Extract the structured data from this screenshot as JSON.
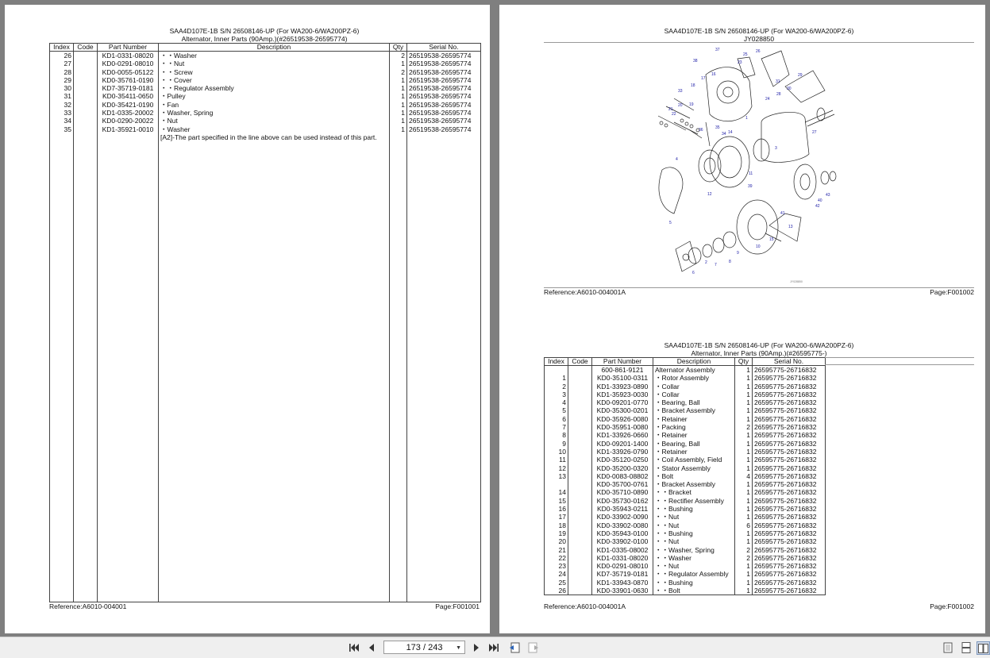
{
  "left_page": {
    "title": "SAA4D107E-1B S/N 26508146-UP (For WA200-6/WA200PZ-6)",
    "subtitle": "Alternator, Inner Parts (90Amp.)(#26519538-26595774)",
    "columns": [
      "Index",
      "Code",
      "Part Number",
      "Description",
      "Qty",
      "Serial No."
    ],
    "rows": [
      [
        "26",
        "",
        "KD1-0331-08020",
        "・・Washer",
        "2",
        "26519538-26595774"
      ],
      [
        "27",
        "",
        "KD0-0291-08010",
        "・・Nut",
        "1",
        "26519538-26595774"
      ],
      [
        "28",
        "",
        "KD0-0055-05122",
        "・・Screw",
        "2",
        "26519538-26595774"
      ],
      [
        "29",
        "",
        "KD0-35761-0190",
        "・・Cover",
        "1",
        "26519538-26595774"
      ],
      [
        "30",
        "",
        "KD7-35719-0181",
        "・・Regulator Assembly",
        "1",
        "26519538-26595774"
      ],
      [
        "31",
        "",
        "KD0-35411-0650",
        "・Pulley",
        "1",
        "26519538-26595774"
      ],
      [
        "32",
        "",
        "KD0-35421-0190",
        "・Fan",
        "1",
        "26519538-26595774"
      ],
      [
        "33",
        "",
        "KD1-0335-20002",
        "・Washer, Spring",
        "1",
        "26519538-26595774"
      ],
      [
        "34",
        "",
        "KD0-0290-20022",
        "・Nut",
        "1",
        "26519538-26595774"
      ],
      [
        "35",
        "",
        "KD1-35921-0010",
        "・Washer",
        "1",
        "26519538-26595774"
      ]
    ],
    "note": "[A2]-The part specified in the line above can be used instead of this part.",
    "reference": "Reference:A6010-004001",
    "page": "Page:F001001"
  },
  "right_page": {
    "diagram_title": "SAA4D107E-1B S/N 26508146-UP (For WA200-6/WA200PZ-6)",
    "diagram_code": "JY028850",
    "diagram_labels": [
      "37",
      "38",
      "25",
      "26",
      "23",
      "29",
      "30",
      "28",
      "24",
      "31",
      "33",
      "18",
      "17",
      "16",
      "22",
      "21",
      "20",
      "19",
      "36",
      "35",
      "34",
      "14",
      "1",
      "3",
      "27",
      "4",
      "11",
      "12",
      "39",
      "41",
      "42",
      "43",
      "40",
      "13",
      "15",
      "5",
      "10",
      "9",
      "8",
      "7",
      "6",
      "2"
    ],
    "diagram_reference": "Reference:A6010-004001A",
    "diagram_page": "Page:F001002",
    "title": "SAA4D107E-1B S/N 26508146-UP (For WA200-6/WA200PZ-6)",
    "subtitle": "Alternator, Inner Parts (90Amp.)(#26595775-)",
    "columns": [
      "Index",
      "Code",
      "Part Number",
      "Description",
      "Qty",
      "Serial No."
    ],
    "rows": [
      [
        "",
        "",
        "600-861-9121",
        "Alternator Assembly",
        "1",
        "26595775-26716832"
      ],
      [
        "1",
        "",
        "KD0-35100-0311",
        "・Rotor Assembly",
        "1",
        "26595775-26716832"
      ],
      [
        "2",
        "",
        "KD1-33923-0890",
        "・Collar",
        "1",
        "26595775-26716832"
      ],
      [
        "3",
        "",
        "KD1-35923-0030",
        "・Collar",
        "1",
        "26595775-26716832"
      ],
      [
        "4",
        "",
        "KD0-09201-0770",
        "・Bearing, Ball",
        "1",
        "26595775-26716832"
      ],
      [
        "5",
        "",
        "KD0-35300-0201",
        "・Bracket Assembly",
        "1",
        "26595775-26716832"
      ],
      [
        "6",
        "",
        "KD0-35926-0080",
        "・Retainer",
        "1",
        "26595775-26716832"
      ],
      [
        "7",
        "",
        "KD0-35951-0080",
        "・Packing",
        "2",
        "26595775-26716832"
      ],
      [
        "8",
        "",
        "KD1-33926-0660",
        "・Retainer",
        "1",
        "26595775-26716832"
      ],
      [
        "9",
        "",
        "KD0-09201-1400",
        "・Bearing, Ball",
        "1",
        "26595775-26716832"
      ],
      [
        "10",
        "",
        "KD1-33926-0790",
        "・Retainer",
        "1",
        "26595775-26716832"
      ],
      [
        "11",
        "",
        "KD0-35120-0250",
        "・Coil Assembly, Field",
        "1",
        "26595775-26716832"
      ],
      [
        "12",
        "",
        "KD0-35200-0320",
        "・Stator Assembly",
        "1",
        "26595775-26716832"
      ],
      [
        "13",
        "",
        "KD0-0083-08802",
        "・Bolt",
        "4",
        "26595775-26716832"
      ],
      [
        "",
        "",
        "KD0-35700-0761",
        "・Bracket Assembly",
        "1",
        "26595775-26716832"
      ],
      [
        "14",
        "",
        "KD0-35710-0890",
        "・・Bracket",
        "1",
        "26595775-26716832"
      ],
      [
        "15",
        "",
        "KD0-35730-0162",
        "・・Rectifier Assembly",
        "1",
        "26595775-26716832"
      ],
      [
        "16",
        "",
        "KD0-35943-0211",
        "・・Bushing",
        "1",
        "26595775-26716832"
      ],
      [
        "17",
        "",
        "KD0-33902-0090",
        "・・Nut",
        "1",
        "26595775-26716832"
      ],
      [
        "18",
        "",
        "KD0-33902-0080",
        "・・Nut",
        "6",
        "26595775-26716832"
      ],
      [
        "19",
        "",
        "KD0-35943-0100",
        "・・Bushing",
        "1",
        "26595775-26716832"
      ],
      [
        "20",
        "",
        "KD0-33902-0100",
        "・・Nut",
        "1",
        "26595775-26716832"
      ],
      [
        "21",
        "",
        "KD1-0335-08002",
        "・・Washer, Spring",
        "2",
        "26595775-26716832"
      ],
      [
        "22",
        "",
        "KD1-0331-08020",
        "・・Washer",
        "2",
        "26595775-26716832"
      ],
      [
        "23",
        "",
        "KD0-0291-08010",
        "・・Nut",
        "1",
        "26595775-26716832"
      ],
      [
        "24",
        "",
        "KD7-35719-0181",
        "・・Regulator Assembly",
        "1",
        "26595775-26716832"
      ],
      [
        "25",
        "",
        "KD1-33943-0870",
        "・・Bushing",
        "1",
        "26595775-26716832"
      ],
      [
        "26",
        "",
        "KD0-33901-0630",
        "・・Bolt",
        "1",
        "26595775-26716832"
      ]
    ],
    "reference": "Reference:A6010-004001A",
    "page": "Page:F001002"
  },
  "toolbar": {
    "page_indicator": "173 / 243",
    "icons": [
      "first-page-icon",
      "prev-page-icon",
      "next-page-icon",
      "last-page-icon",
      "back-history-icon",
      "forward-history-icon",
      "single-page-view-icon",
      "continuous-view-icon",
      "facing-view-icon"
    ]
  }
}
